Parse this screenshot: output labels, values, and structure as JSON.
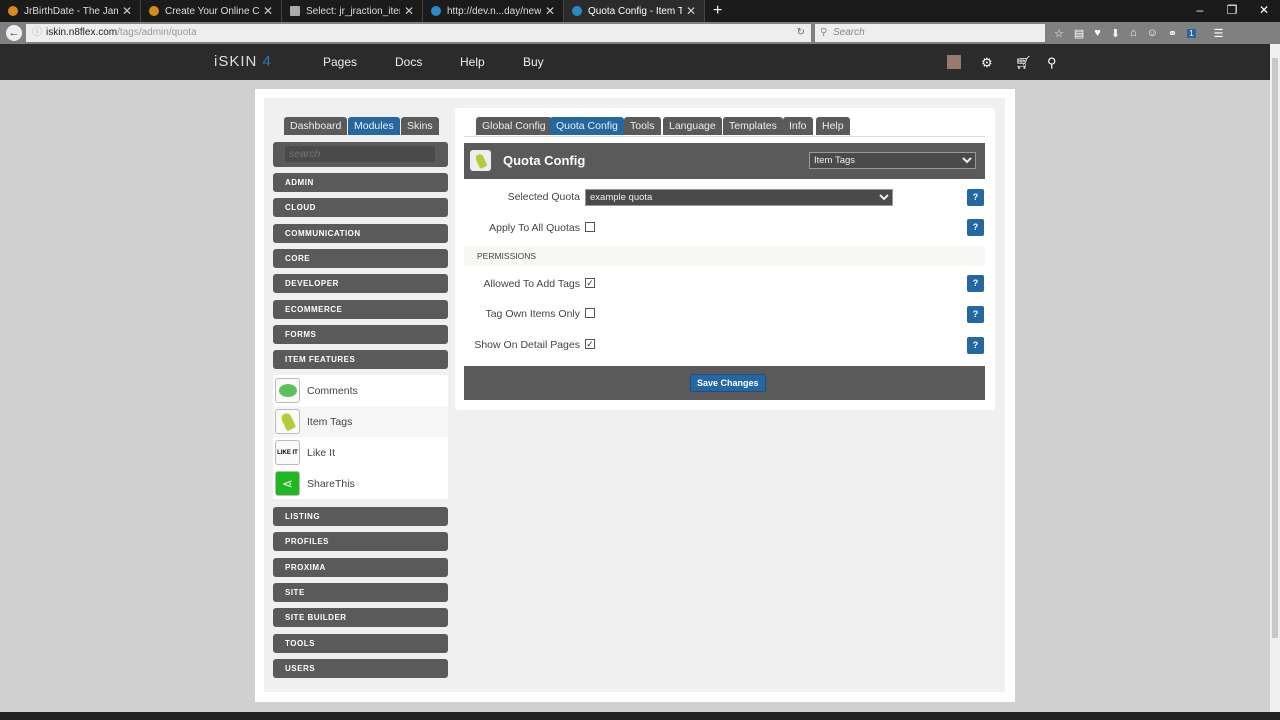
{
  "browser": {
    "tabs": [
      {
        "label": "JrBirthDate - The Jamroo..."
      },
      {
        "label": "Create Your Online Com..."
      },
      {
        "label": "Select: jr_jraction_item_ke..."
      },
      {
        "label": "http://dev.n...day/new_day"
      },
      {
        "label": "Quota Config - Item Tags ..."
      }
    ],
    "url_host": "iskin.n8flex.com",
    "url_path": "/tags/admin/quota",
    "url_prefix": "",
    "search_placeholder": "Search",
    "badge": "1"
  },
  "nav": {
    "logo_text": "iSKIN",
    "logo_version": "4",
    "links": [
      "Pages",
      "Docs",
      "Help",
      "Buy"
    ]
  },
  "sidebar": {
    "tabs": [
      "Dashboard",
      "Modules",
      "Skins"
    ],
    "search_placeholder": "search",
    "categories_top": [
      "ADMIN",
      "CLOUD",
      "COMMUNICATION",
      "CORE",
      "DEVELOPER",
      "ECOMMERCE",
      "FORMS",
      "ITEM FEATURES"
    ],
    "modules": [
      "Comments",
      "Item Tags",
      "Like It",
      "ShareThis"
    ],
    "likeit_icon_text": "LIKE IT",
    "categories_bottom": [
      "LISTING",
      "PROFILES",
      "PROXIMA",
      "SITE",
      "SITE BUILDER",
      "TOOLS",
      "USERS"
    ]
  },
  "main": {
    "tabs": [
      "Global Config",
      "Quota Config",
      "Tools",
      "Language",
      "Templates",
      "Info",
      "Help"
    ],
    "title": "Quota Config",
    "module_select": "Item Tags",
    "fields": {
      "selected_quota_label": "Selected Quota",
      "selected_quota_value": "example quota",
      "apply_all_label": "Apply To All Quotas",
      "apply_all_checked": false,
      "section": "PERMISSIONS",
      "allowed_add_label": "Allowed To Add Tags",
      "allowed_add_checked": true,
      "own_items_label": "Tag Own Items Only",
      "own_items_checked": false,
      "detail_pages_label": "Show On Detail Pages",
      "detail_pages_checked": true
    },
    "help_label": "?",
    "save_label": "Save Changes"
  },
  "colors": {
    "accent": "#2567a0",
    "panel": "#5a5a5a"
  }
}
